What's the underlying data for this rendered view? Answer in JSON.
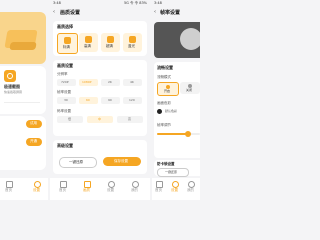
{
  "accent": "#f5a623",
  "left": {
    "status_time": "",
    "badge": "",
    "product_title": "极速截图",
    "product_subtitle": "快速截取屏幕",
    "btn1": "试用",
    "btn2": "开通",
    "nav": [
      "首页",
      "设置"
    ]
  },
  "middle": {
    "status_time": "3:48",
    "status_right": "5G 令 令 83%",
    "title": "画质设置",
    "section1_title": "画质选择",
    "quality_options": [
      "标清",
      "高清",
      "超清",
      "蓝光"
    ],
    "section2_title": "画质设置",
    "res_label": "分辨率",
    "res_options": [
      "720P",
      "1080P",
      "2K",
      "4K"
    ],
    "fps_label": "帧率设置",
    "fps_options": [
      "30",
      "60",
      "90",
      "120"
    ],
    "bitrate_label": "码率设置",
    "bitrate_options": [
      "低",
      "中",
      "高"
    ],
    "section3_title": "高级设置",
    "reset_button": "一键还原",
    "save_button": "保存设置",
    "nav": [
      "首页",
      "画质",
      "设置",
      "我的"
    ]
  },
  "right": {
    "status_time": "3:48",
    "title": "帧率设置",
    "section1_title": "流畅设置",
    "row1_label": "流畅模式",
    "opt1": "开启",
    "opt2": "关闭",
    "row2_label": "画面色彩",
    "color_option": "默认色彩",
    "row3_label": "帧率调节",
    "section3_title": "防卡顿设置",
    "reset_button": "一键还原",
    "nav": [
      "首页",
      "设置",
      "我的"
    ]
  }
}
